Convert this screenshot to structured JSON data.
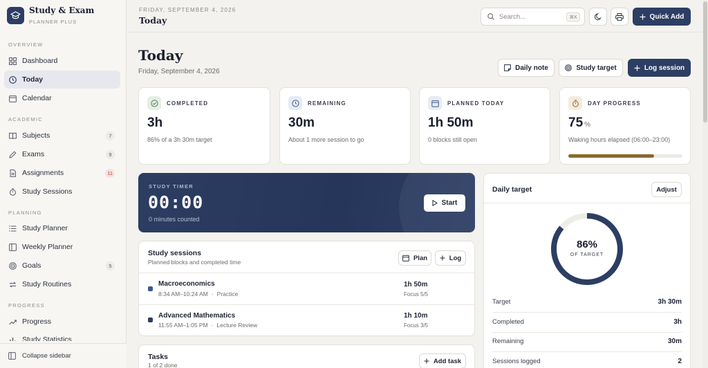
{
  "brand": {
    "title": "Study & Exam",
    "subtitle": "PLANNER PLUS"
  },
  "sidebar": {
    "sections": [
      {
        "label": "OVERVIEW"
      },
      {
        "label": "ACADEMIC"
      },
      {
        "label": "PLANNING"
      },
      {
        "label": "PROGRESS"
      }
    ],
    "items": [
      {
        "label": "Dashboard",
        "icon": "grid-icon"
      },
      {
        "label": "Today",
        "icon": "clock-icon",
        "active": true
      },
      {
        "label": "Calendar",
        "icon": "calendar-icon"
      },
      {
        "label": "Subjects",
        "icon": "book-icon",
        "badge": "7"
      },
      {
        "label": "Exams",
        "icon": "pencil-icon",
        "badge": "9"
      },
      {
        "label": "Assignments",
        "icon": "document-icon",
        "badge": "11"
      },
      {
        "label": "Study Sessions",
        "icon": "stopwatch-icon"
      },
      {
        "label": "Study Planner",
        "icon": "list-icon"
      },
      {
        "label": "Weekly Planner",
        "icon": "columns-icon"
      },
      {
        "label": "Goals",
        "icon": "target-icon",
        "badge": "5"
      },
      {
        "label": "Study Routines",
        "icon": "repeat-icon"
      },
      {
        "label": "Progress",
        "icon": "trend-icon"
      },
      {
        "label": "Study Statistics",
        "icon": "bar-chart-icon"
      }
    ],
    "collapse_label": "Collapse sidebar"
  },
  "header": {
    "date": "FRIDAY, SEPTEMBER 4, 2026",
    "title": "Today",
    "search_placeholder": "Search...",
    "search_shortcut": "⌘K",
    "quick_add": "Quick Add"
  },
  "page": {
    "title": "Today",
    "date": "Friday, September 4, 2026",
    "actions": {
      "daily_note": "Daily note",
      "study_target": "Study target",
      "log_session": "Log session"
    }
  },
  "stats": [
    {
      "label": "COMPLETED",
      "value": "3h",
      "unit": "",
      "sub": "86% of a 3h 30m target",
      "icon": "check-circle-icon",
      "color": "#e6efe6"
    },
    {
      "label": "REMAINING",
      "value": "30m",
      "unit": "",
      "sub": "About 1 more session to go",
      "icon": "clock-icon",
      "color": "#e7ebf3"
    },
    {
      "label": "PLANNED TODAY",
      "value": "1h 50m",
      "unit": "",
      "sub": "0 blocks still open",
      "icon": "calendar-icon",
      "color": "#e7ebf3"
    },
    {
      "label": "DAY PROGRESS",
      "value": "75",
      "unit": "%",
      "sub": "Waking hours elapsed (06:00–23:00)",
      "icon": "stopwatch-icon",
      "color": "#f4ebdc",
      "progress": 0.75
    }
  ],
  "timer": {
    "label": "STUDY TIMER",
    "time": "00:00",
    "sub": "0 minutes counted",
    "start": "Start"
  },
  "sessions": {
    "title": "Study sessions",
    "subtitle": "Planned blocks and completed time",
    "plan_label": "Plan",
    "log_label": "Log",
    "items": [
      {
        "name": "Macroeconomics",
        "time": "8:34 AM–10:24 AM",
        "type": "Practice",
        "duration": "1h 50m",
        "focus": "Focus 5/5",
        "color": "#3d5a8c"
      },
      {
        "name": "Advanced Mathematics",
        "time": "11:55 AM–1:05 PM",
        "type": "Lecture Review",
        "duration": "1h 10m",
        "focus": "Focus 3/5",
        "color": "#2c3e63"
      }
    ]
  },
  "tasks": {
    "title": "Tasks",
    "subtitle": "1 of 2 done",
    "add_label": "Add task"
  },
  "daily_target": {
    "title": "Daily target",
    "adjust": "Adjust",
    "percent": "86%",
    "percent_value": 0.86,
    "ring_label": "OF TARGET",
    "rows": [
      {
        "label": "Target",
        "value": "3h 30m"
      },
      {
        "label": "Completed",
        "value": "3h"
      },
      {
        "label": "Remaining",
        "value": "30m"
      },
      {
        "label": "Sessions logged",
        "value": "2"
      }
    ]
  },
  "colors": {
    "accent": "#2c3e63",
    "progress": "#8a6a2e"
  }
}
